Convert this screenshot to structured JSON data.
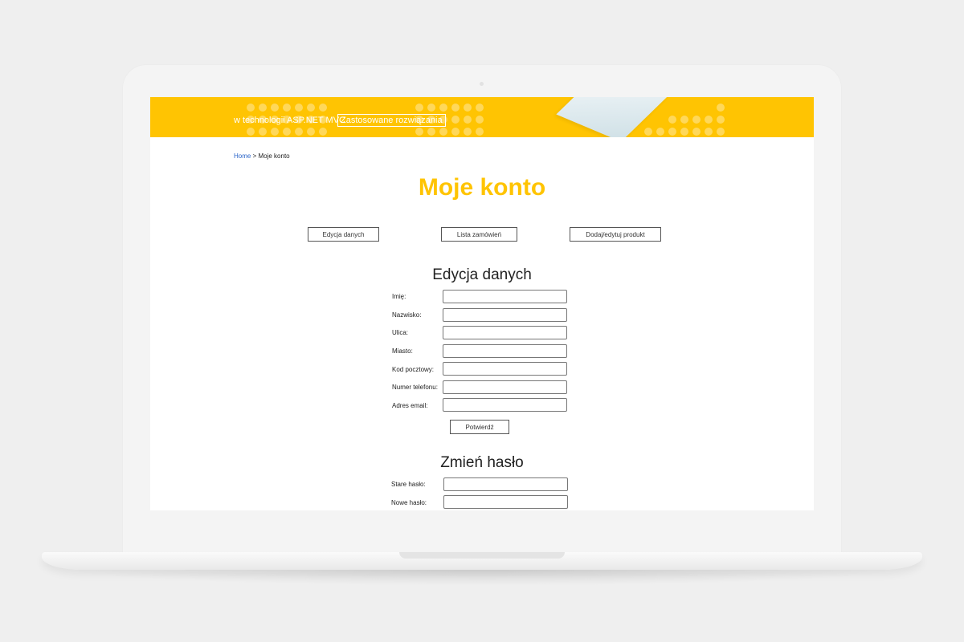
{
  "banner": {
    "text": "w technologii ASP.NET MVC",
    "tag": "Zastosowane rozwiązania",
    "accent_color": "#ffc402"
  },
  "breadcrumb": {
    "home": "Home",
    "separator": ">",
    "current": "Moje konto"
  },
  "page_title": "Moje konto",
  "tabs": [
    {
      "label": "Edycja danych"
    },
    {
      "label": "Lista zamówień"
    },
    {
      "label": "Dodaj/edytuj produkt"
    }
  ],
  "edit_section": {
    "title": "Edycja danych",
    "fields": [
      {
        "label": "Imię:",
        "value": ""
      },
      {
        "label": "Nazwisko:",
        "value": ""
      },
      {
        "label": "Ulica:",
        "value": ""
      },
      {
        "label": "Miasto:",
        "value": ""
      },
      {
        "label": "Kod pocztowy:",
        "value": ""
      },
      {
        "label": "Numer telefonu:",
        "value": ""
      },
      {
        "label": "Adres email:",
        "value": ""
      }
    ],
    "submit_label": "Potwierdź"
  },
  "password_section": {
    "title": "Zmień hasło",
    "fields": [
      {
        "label": "Stare hasło:",
        "value": ""
      },
      {
        "label": "Nowe hasło:",
        "value": ""
      }
    ]
  }
}
